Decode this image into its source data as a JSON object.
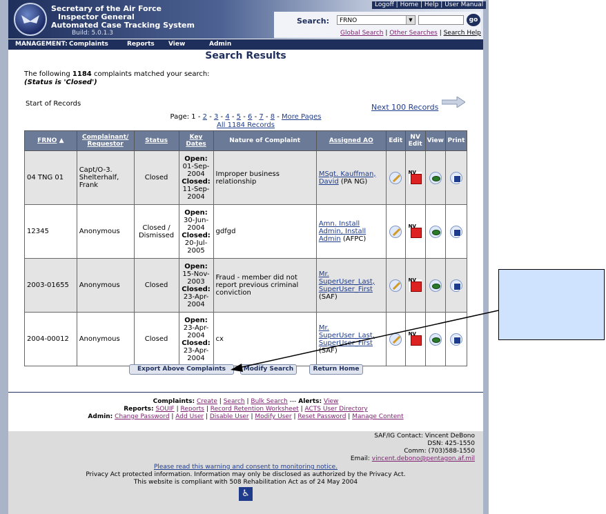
{
  "header": {
    "title_line1": "Secretary of the Air Force",
    "title_line2": "Inspector General",
    "title_line3": "Automated Case Tracking System",
    "build": "Build: 5.0.1.3",
    "toplinks": [
      "Logoff",
      "Home",
      "Help",
      "User Manual"
    ],
    "search_label": "Search:",
    "search_select": "FRNO",
    "go_label": "go",
    "search_links": [
      "Global Search",
      "Other Searches",
      "Search Help"
    ]
  },
  "navbar": {
    "label": "MANAGEMENT:",
    "items": [
      "Complaints",
      "Reports",
      "View",
      "Admin"
    ]
  },
  "main": {
    "title": "Search Results",
    "intro_prefix": "The following",
    "count": "1184",
    "intro_suffix": "complaints matched your search:",
    "status_filter": "(Status is 'Closed')",
    "start_records": "Start of Records",
    "next_records": "Next 100 Records",
    "pager_prefix": "Page: 1 -",
    "pager_pages": [
      "2",
      "3",
      "4",
      "5",
      "6",
      "7",
      "8"
    ],
    "pager_more": "More Pages",
    "all_records": "All 1184 Records"
  },
  "table": {
    "headers": [
      "FRNO",
      "Complainant/ Requestor",
      "Status",
      "Key Dates",
      "Nature of Complaint",
      "Assigned AO",
      "Edit",
      "NV Edit",
      "View",
      "Print"
    ],
    "rows": [
      {
        "frno": "04 TNG 01",
        "complainant": "Capt/O-3. Shelterhalf, Frank",
        "status": "Closed",
        "open_label": "Open:",
        "open": "01-Sep-2004",
        "closed_label": "Closed:",
        "closed": "11-Sep-2004",
        "nature": "Improper business relationship",
        "ao_link": "MSgt. Kauffman, David",
        "ao_org": "(PA NG)"
      },
      {
        "frno": "12345",
        "complainant": "Anonymous",
        "status": "Closed / Dismissed",
        "open_label": "Open:",
        "open": "30-Jun-2004",
        "closed_label": "Closed:",
        "closed": "20-Jul-2005",
        "nature": "gdfgd",
        "ao_link": "Amn. Install Admin, Install Admin",
        "ao_org": "(AFPC)"
      },
      {
        "frno": "2003-01655",
        "complainant": "Anonymous",
        "status": "Closed",
        "open_label": "Open:",
        "open": "15-Nov-2003",
        "closed_label": "Closed:",
        "closed": "23-Apr-2004",
        "nature": "Fraud - member did not report previous criminal conviction",
        "ao_link": "Mr. SuperUser_Last, SuperUser_First",
        "ao_org": "(SAF)"
      },
      {
        "frno": "2004-00012",
        "complainant": "Anonymous",
        "status": "Closed",
        "open_label": "Open:",
        "open": "23-Apr-2004",
        "closed_label": "Closed:",
        "closed": "23-Apr-2004",
        "nature": "cx",
        "ao_link": "Mr. SuperUser_Last, SuperUser_First",
        "ao_org": "(SAF)"
      }
    ]
  },
  "buttons": {
    "export": "Export Above Complaints",
    "modify": "Modify Search",
    "home": "Return Home"
  },
  "footer": {
    "complaints_label": "Complaints:",
    "complaints_links": [
      "Create",
      "Search",
      "Bulk Search"
    ],
    "alerts_sep": "---",
    "alerts_label": "Alerts:",
    "alerts_link": "View",
    "reports_label": "Reports:",
    "reports_links": [
      "SOUIF",
      "Reports",
      "Record Retention Worksheet",
      "ACTS User Directory"
    ],
    "admin_label": "Admin:",
    "admin_links": [
      "Change Password",
      "Add User",
      "Disable User",
      "Modify User",
      "Reset Password",
      "Manage Content"
    ],
    "contact_line1": "SAF/IG Contact: Vincent DeBono",
    "contact_line2": "DSN: 425-1550",
    "contact_line3": "Comm: (703)588-1550",
    "email_label": "Email:",
    "email": "vincent.debono@pentagon.af.mil",
    "warning_link": "Please read this warning and consent to monitoring notice.",
    "privacy": "Privacy Act protected information. Information may only be disclosed as authorized by the Privacy Act.",
    "compliance": "This website is compliant with 508 Rehabilitation Act as of 24 May 2004"
  },
  "colors": {
    "navy": "#1f2f5c",
    "header_gray": "#6b7a96",
    "callout_fill": "#cfe3ff",
    "link_purple": "#7b1f6e"
  }
}
